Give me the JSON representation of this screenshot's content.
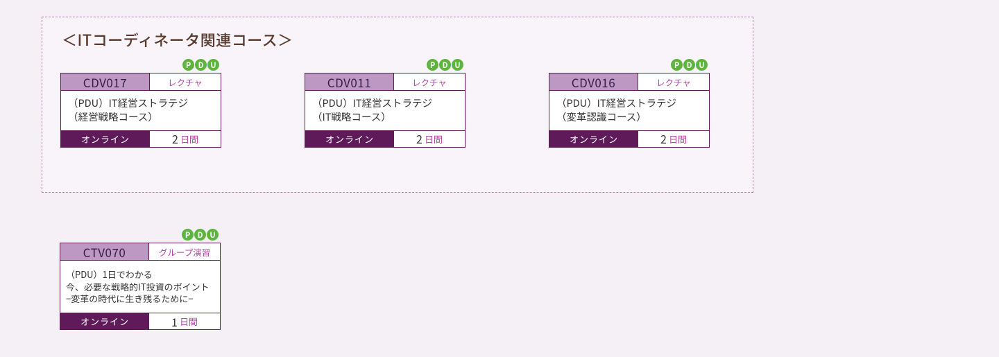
{
  "section": {
    "title": "＜ITコーディネータ関連コース＞"
  },
  "pdu": {
    "p": "P",
    "d": "D",
    "u": "U"
  },
  "cards": [
    {
      "code": "CDV017",
      "type": "レクチャ",
      "title_l1": "（PDU）IT経営ストラテジ",
      "title_l2": "（経営戦略コース）",
      "mode": "オンライン",
      "days_num": "2",
      "days_unit": "日間"
    },
    {
      "code": "CDV011",
      "type": "レクチャ",
      "title_l1": "（PDU）IT経営ストラテジ",
      "title_l2": "（IT戦略コース）",
      "mode": "オンライン",
      "days_num": "2",
      "days_unit": "日間"
    },
    {
      "code": "CDV016",
      "type": "レクチャ",
      "title_l1": "（PDU）IT経営ストラテジ",
      "title_l2": "（変革認識コース）",
      "mode": "オンライン",
      "days_num": "2",
      "days_unit": "日間"
    },
    {
      "code": "CTV070",
      "type": "グループ演習",
      "title_l1": "（PDU）1日でわかる",
      "title_l2": "今、必要な戦略的IT投資のポイント",
      "title_l3": "−変革の時代に生き残るために−",
      "mode": "オンライン",
      "days_num": "1",
      "days_unit": "日間"
    }
  ]
}
